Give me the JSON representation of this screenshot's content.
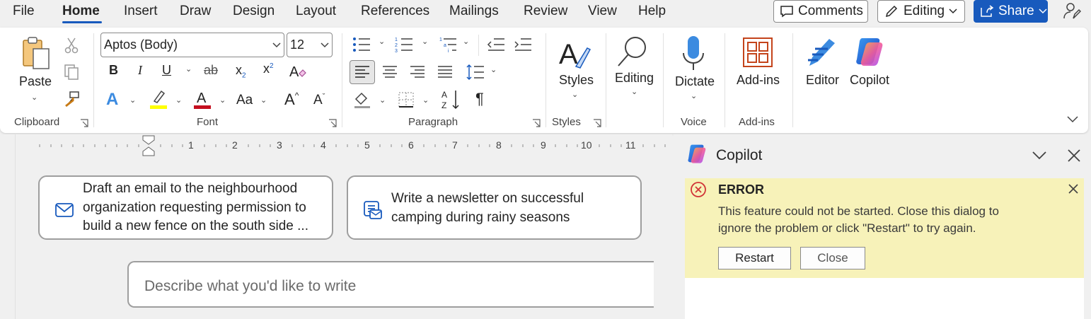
{
  "menu": {
    "items": [
      "File",
      "Home",
      "Insert",
      "Draw",
      "Design",
      "Layout",
      "References",
      "Mailings",
      "Review",
      "View",
      "Help"
    ],
    "active": "Home",
    "comments_label": "Comments",
    "editing_label": "Editing",
    "share_label": "Share"
  },
  "ribbon": {
    "clipboard": {
      "paste_label": "Paste",
      "group_label": "Clipboard"
    },
    "font": {
      "font_name": "Aptos (Body)",
      "font_size": "12",
      "group_label": "Font",
      "change_case_label": "Aa"
    },
    "paragraph": {
      "group_label": "Paragraph"
    },
    "styles": {
      "styles_label": "Styles",
      "group_label": "Styles"
    },
    "editing": {
      "editing_label": "Editing"
    },
    "voice": {
      "dictate_label": "Dictate",
      "group_label": "Voice"
    },
    "addins": {
      "addins_label": "Add-ins",
      "group_label": "Add-ins"
    },
    "editor_label": "Editor",
    "copilot_label": "Copilot"
  },
  "ruler": {
    "numbers": [
      "1",
      "2",
      "3",
      "4",
      "5",
      "6",
      "7",
      "8",
      "9",
      "10",
      "11"
    ]
  },
  "document": {
    "prompt1": [
      "Draft an email to the neighbourhood",
      "organization requesting permission to",
      "build a new fence on the south side ..."
    ],
    "prompt2": [
      "Write a newsletter on successful",
      "camping during rainy seasons"
    ],
    "describe_placeholder": "Describe what you'd like to write"
  },
  "copilot_pane": {
    "title": "Copilot",
    "error": {
      "title": "ERROR",
      "message_line1": "This feature could not be started. Close this dialog to",
      "message_line2": "ignore the problem or click \"Restart\" to try again.",
      "restart_label": "Restart",
      "close_label": "Close"
    }
  },
  "colors": {
    "accent": "#185abd",
    "error_background": "#f7f2b9",
    "error_icon": "#d13438",
    "highlight": "#ffff00",
    "font_color": "#c50f1f"
  }
}
